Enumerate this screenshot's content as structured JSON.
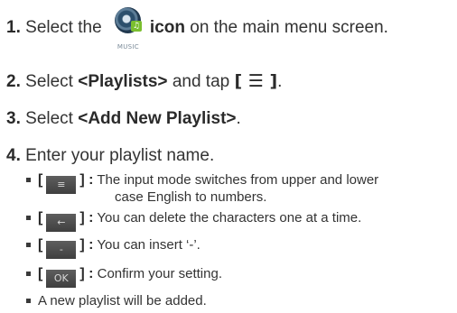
{
  "steps": [
    {
      "num": "1.",
      "pre": "Select the",
      "bold": "icon",
      "post": "on the main menu screen."
    },
    {
      "num": "2.",
      "pre": "Select",
      "bold1": "<Playlists>",
      "mid": "and tap",
      "bold2": "[ ☰ ]",
      "post": "."
    },
    {
      "num": "3.",
      "pre": "Select",
      "bold": "<Add New Playlist>",
      "post": "."
    },
    {
      "num": "4.",
      "text": "Enter your playlist name."
    }
  ],
  "music_icon": {
    "icon": "music-icon",
    "caption": "MUSIC"
  },
  "bullets": [
    {
      "open": "[",
      "key": "≡",
      "key_icon": "menu-icon",
      "close": "] :",
      "text": "The input mode switches from upper and lower",
      "text2": "case English to numbers."
    },
    {
      "open": "[",
      "key": "←",
      "key_icon": "backspace-icon",
      "close": "] :",
      "text": "You can delete the characters one at a time."
    },
    {
      "open": "[",
      "key": "-",
      "key_icon": "dash-icon",
      "close": "] :",
      "text": "You can insert ‘-’."
    },
    {
      "open": "[",
      "key": "OK",
      "key_icon": "ok-icon",
      "close": "] :",
      "text": "Confirm your setting."
    },
    {
      "text": "A new playlist will be added."
    }
  ]
}
